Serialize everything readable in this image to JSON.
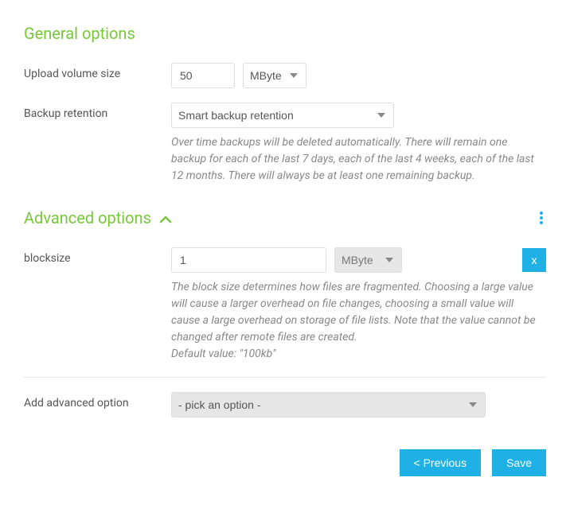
{
  "general": {
    "title": "General options",
    "upload_volume": {
      "label": "Upload volume size",
      "value": "50",
      "unit": "MByte"
    },
    "backup_retention": {
      "label": "Backup retention",
      "selected": "Smart backup retention",
      "help": "Over time backups will be deleted automatically. There will remain one backup for each of the last 7 days, each of the last 4 weeks, each of the last 12 months. There will always be at least one remaining backup."
    }
  },
  "advanced": {
    "title": "Advanced options",
    "blocksize": {
      "label": "blocksize",
      "value": "1",
      "unit": "MByte",
      "help": "The block size determines how files are fragmented. Choosing a large value will cause a larger overhead on file changes, choosing a small value will cause a large overhead on storage of file lists. Note that the value cannot be changed after remote files are created.",
      "default": "Default value: \"100kb\"",
      "remove_label": "x"
    },
    "add_option": {
      "label": "Add advanced option",
      "placeholder": "- pick an option -"
    }
  },
  "footer": {
    "previous": "< Previous",
    "save": "Save"
  }
}
